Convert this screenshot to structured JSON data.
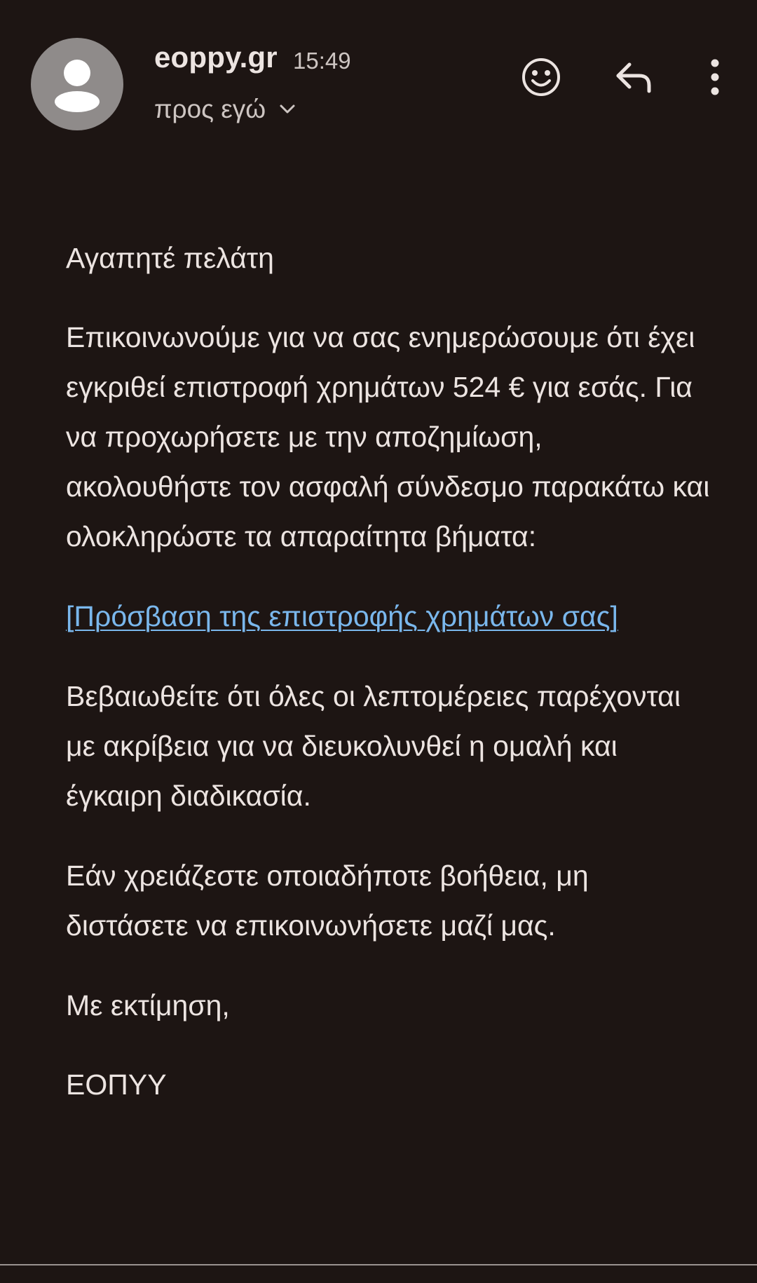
{
  "header": {
    "sender_name": "eoppy.gr",
    "time": "15:49",
    "recipient_label": "προς εγώ",
    "icons": {
      "avatar": "person-avatar-icon",
      "recipient_expand": "chevron-down-icon",
      "emoji": "emoji-smile-icon",
      "reply": "reply-icon",
      "more": "more-vert-icon"
    }
  },
  "email_body": {
    "greeting": "Αγαπητέ πελάτη",
    "main_paragraph": "Επικοινωνούμε για να σας ενημερώσουμε ότι έχει εγκριθεί επιστροφή χρημάτων 524 € για εσάς. Για να προχωρήσετε με την αποζημίωση, ακολουθήστε τον ασφαλή σύνδεσμο παρακάτω και ολοκληρώστε τα απαραίτητα βήματα:",
    "link_text": "[Πρόσβαση της επιστροφής χρημάτων σας]",
    "confirm_paragraph": "Βεβαιωθείτε ότι όλες οι λεπτομέρειες παρέχονται με ακρίβεια για να διευκολυνθεί η ομαλή και έγκαιρη διαδικασία.",
    "help_paragraph": "Εάν χρειάζεστε οποιαδήποτε βοήθεια, μη διστάσετε να επικοινωνήσετε μαζί μας.",
    "sign_off": "Με εκτίμηση,",
    "signature": "ΕΟΠΥΥ"
  },
  "colors": {
    "background": "#1d1513",
    "text": "#ece4e1",
    "secondary_text": "#cdc5c2",
    "link": "#7ab7ec",
    "avatar_background": "#8f8b8a"
  }
}
